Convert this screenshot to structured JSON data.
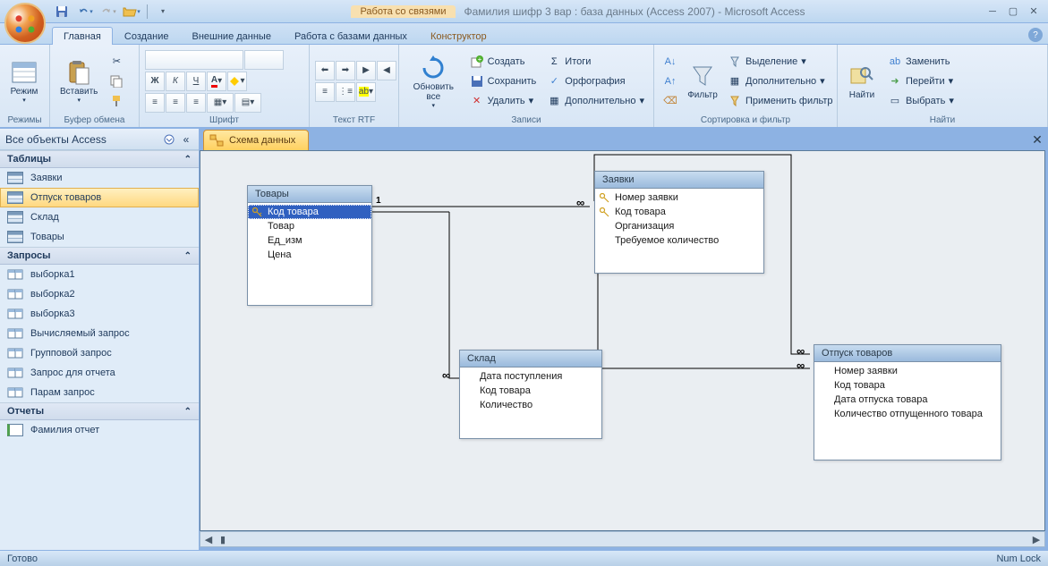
{
  "title": {
    "context_label": "Работа со связями",
    "app_title": "Фамилия шифр 3 вар : база данных (Access 2007) - Microsoft Access"
  },
  "tabs": {
    "home": "Главная",
    "create": "Создание",
    "external": "Внешние данные",
    "dbtools": "Работа с базами данных",
    "constructor": "Конструктор"
  },
  "ribbon": {
    "groups": {
      "modes": "Режимы",
      "clipboard": "Буфер обмена",
      "font": "Шрифт",
      "rtf": "Текст RTF",
      "records": "Записи",
      "sortfilter": "Сортировка и фильтр",
      "find": "Найти"
    },
    "mode": "Режим",
    "paste": "Вставить",
    "refresh_all": "Обновить все",
    "new": "Создать",
    "save": "Сохранить",
    "delete": "Удалить",
    "totals": "Итоги",
    "spelling": "Орфография",
    "more": "Дополнительно",
    "filter": "Фильтр",
    "selection": "Выделение",
    "advanced": "Дополнительно",
    "toggle_filter": "Применить фильтр",
    "find": "Найти",
    "replace": "Заменить",
    "goto": "Перейти",
    "select": "Выбрать"
  },
  "nav": {
    "header": "Все объекты Access",
    "sections": {
      "tables": "Таблицы",
      "queries": "Запросы",
      "reports": "Отчеты"
    },
    "tables": [
      "Заявки",
      "Отпуск товаров",
      "Склад",
      "Товары"
    ],
    "queries": [
      "выборка1",
      "выборка2",
      "выборка3",
      "Вычисляемый запрос",
      "Групповой запрос",
      "Запрос для отчета",
      "Парам запрос"
    ],
    "reports": [
      "Фамилия отчет"
    ]
  },
  "doc": {
    "tab_title": "Схема данных"
  },
  "schema": {
    "tovary": {
      "title": "Товары",
      "fields": [
        "Код товара",
        "Товар",
        "Ед_изм",
        "Цена"
      ]
    },
    "zayavki": {
      "title": "Заявки",
      "fields": [
        "Номер заявки",
        "Код товара",
        "Организация",
        "Требуемое количество"
      ]
    },
    "sklad": {
      "title": "Склад",
      "fields": [
        "Дата поступления",
        "Код товара",
        "Количество"
      ]
    },
    "otpusk": {
      "title": "Отпуск товаров",
      "fields": [
        "Номер заявки",
        "Код товара",
        "Дата отпуска товара",
        "Количество отпущенного товара"
      ]
    }
  },
  "status": {
    "ready": "Готово",
    "numlock": "Num Lock"
  },
  "rel": {
    "one": "1",
    "many": "∞"
  }
}
